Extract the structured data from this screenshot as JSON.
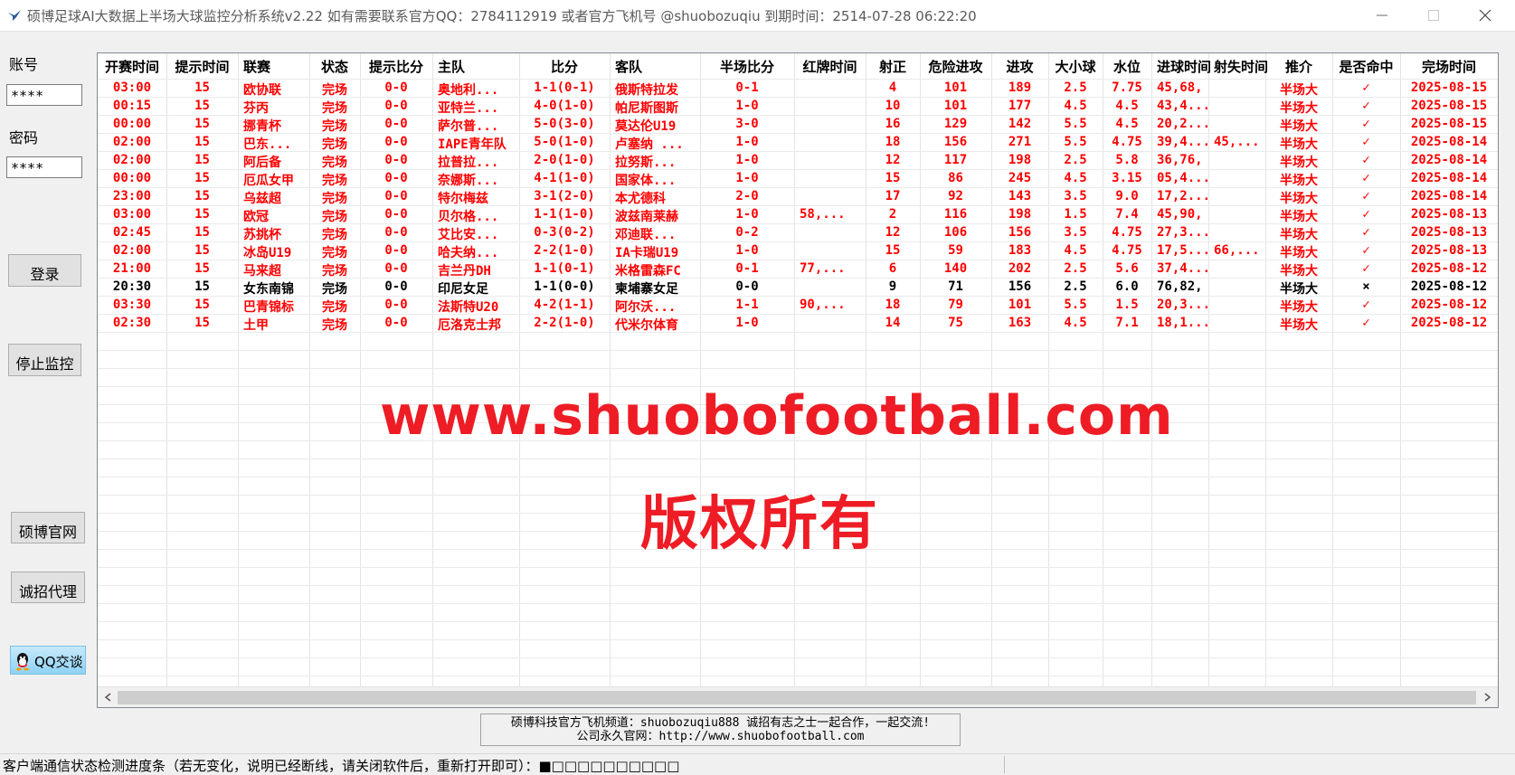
{
  "window": {
    "title": "硕博足球AI大数据上半场大球监控分析系统v2.22 如有需要联系官方QQ：2784112919 或者官方飞机号 @shuobozuqiu   到期时间：2514-07-28 06:22:20"
  },
  "login": {
    "account_label": "账号",
    "account_value": "****",
    "password_label": "密码",
    "password_value": "****",
    "login_button": "登录",
    "stop_button": "停止监控",
    "site_button": "硕博官网",
    "agent_button": "诚招代理",
    "qq_button": "QQ交谈"
  },
  "table": {
    "columns": [
      "开赛时间",
      "提示时间",
      "联赛",
      "状态",
      "提示比分",
      "主队",
      "比分",
      "客队",
      "半场比分",
      "红牌时间",
      "射正",
      "危险进攻",
      "进攻",
      "大小球",
      "水位",
      "进球时间",
      "射失时间",
      "推介",
      "是否命中",
      "完场时间"
    ],
    "rows": [
      [
        "03:00",
        "15",
        "欧协联",
        "完场",
        "0-0",
        "奥地利...",
        "1-1(0-1)",
        "俄斯特拉发",
        "0-1",
        "",
        "4",
        "101",
        "189",
        "2.5",
        "7.75",
        "45,68,",
        "",
        "半场大",
        "✓",
        "2025-08-15"
      ],
      [
        "00:15",
        "15",
        "芬丙",
        "完场",
        "0-0",
        "亚特兰...",
        "4-0(1-0)",
        "帕尼斯图斯",
        "1-0",
        "",
        "10",
        "101",
        "177",
        "4.5",
        "4.5",
        "43,4...",
        "",
        "半场大",
        "✓",
        "2025-08-15"
      ],
      [
        "00:00",
        "15",
        "挪青杯",
        "完场",
        "0-0",
        "萨尔普...",
        "5-0(3-0)",
        "莫达伦U19",
        "3-0",
        "",
        "16",
        "129",
        "142",
        "5.5",
        "4.5",
        "20,2...",
        "",
        "半场大",
        "✓",
        "2025-08-15"
      ],
      [
        "02:00",
        "15",
        "巴东...",
        "完场",
        "0-0",
        "IAPE青年队",
        "5-0(1-0)",
        "卢塞纳 ...",
        "1-0",
        "",
        "18",
        "156",
        "271",
        "5.5",
        "4.75",
        "39,4...",
        "45,...",
        "半场大",
        "✓",
        "2025-08-14"
      ],
      [
        "02:00",
        "15",
        "阿后备",
        "完场",
        "0-0",
        "拉普拉...",
        "2-0(1-0)",
        "拉努斯...",
        "1-0",
        "",
        "12",
        "117",
        "198",
        "2.5",
        "5.8",
        "36,76,",
        "",
        "半场大",
        "✓",
        "2025-08-14"
      ],
      [
        "00:00",
        "15",
        "厄瓜女甲",
        "完场",
        "0-0",
        "奈娜斯...",
        "4-1(1-0)",
        "国家体...",
        "1-0",
        "",
        "15",
        "86",
        "245",
        "4.5",
        "3.15",
        "05,4...",
        "",
        "半场大",
        "✓",
        "2025-08-14"
      ],
      [
        "23:00",
        "15",
        "乌兹超",
        "完场",
        "0-0",
        "特尔梅兹",
        "3-1(2-0)",
        "本尤德科",
        "2-0",
        "",
        "17",
        "92",
        "143",
        "3.5",
        "9.0",
        "17,2...",
        "",
        "半场大",
        "✓",
        "2025-08-14"
      ],
      [
        "03:00",
        "15",
        "欧冠",
        "完场",
        "0-0",
        "贝尔格...",
        "1-1(1-0)",
        "波兹南莱赫",
        "1-0",
        "58,...",
        "2",
        "116",
        "198",
        "1.5",
        "7.4",
        "45,90,",
        "",
        "半场大",
        "✓",
        "2025-08-13"
      ],
      [
        "02:45",
        "15",
        "苏挑杯",
        "完场",
        "0-0",
        "艾比安...",
        "0-3(0-2)",
        "邓迪联...",
        "0-2",
        "",
        "12",
        "106",
        "156",
        "3.5",
        "4.75",
        "27,3...",
        "",
        "半场大",
        "✓",
        "2025-08-13"
      ],
      [
        "02:00",
        "15",
        "冰岛U19",
        "完场",
        "0-0",
        "哈夫纳...",
        "2-2(1-0)",
        "IA卡瑞U19",
        "1-0",
        "",
        "15",
        "59",
        "183",
        "4.5",
        "4.75",
        "17,5...",
        "66,...",
        "半场大",
        "✓",
        "2025-08-13"
      ],
      [
        "21:00",
        "15",
        "马来超",
        "完场",
        "0-0",
        "吉兰丹DH",
        "1-1(0-1)",
        "米格雷森FC",
        "0-1",
        "77,...",
        "6",
        "140",
        "202",
        "2.5",
        "5.6",
        "37,4...",
        "",
        "半场大",
        "✓",
        "2025-08-12"
      ],
      [
        "20:30",
        "15",
        "女东南锦",
        "完场",
        "0-0",
        "印尼女足",
        "1-1(0-0)",
        "柬埔寨女足",
        "0-0",
        "",
        "9",
        "71",
        "156",
        "2.5",
        "6.0",
        "76,82,",
        "",
        "半场大",
        "×",
        "2025-08-12"
      ],
      [
        "03:30",
        "15",
        "巴青锦标",
        "完场",
        "0-0",
        "法斯特U20",
        "4-2(1-1)",
        "阿尔沃...",
        "1-1",
        "90,...",
        "18",
        "79",
        "101",
        "5.5",
        "1.5",
        "20,3...",
        "",
        "半场大",
        "✓",
        "2025-08-12"
      ],
      [
        "02:30",
        "15",
        "土甲",
        "完场",
        "0-0",
        "厄洛克士邦",
        "2-2(1-0)",
        "代米尔体育",
        "1-0",
        "",
        "14",
        "75",
        "163",
        "4.5",
        "7.1",
        "18,1...",
        "",
        "半场大",
        "✓",
        "2025-08-12"
      ]
    ],
    "row_colors": [
      "red",
      "red",
      "red",
      "red",
      "red",
      "red",
      "red",
      "red",
      "red",
      "red",
      "red",
      "black",
      "red",
      "red"
    ]
  },
  "watermark": {
    "url": "www.shuobofootball.com",
    "copyright": "版权所有"
  },
  "notice": {
    "line1": "硕博科技官方飞机频道：shuobozuqiu888 诚招有志之士一起合作，一起交流!",
    "line2": "公司永久官网：http://www.shuobofootball.com"
  },
  "status": {
    "text": "客户端通信状态检测进度条（若无变化，说明已经断线，请关闭软件后，重新打开即可）：■□□□□□□□□□□"
  },
  "colors": {
    "row_red": "#ff0000",
    "watermark_red": "#ee1c25"
  }
}
